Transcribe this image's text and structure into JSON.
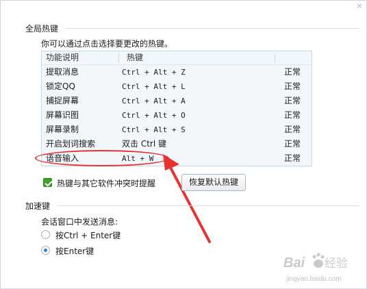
{
  "window": {
    "close_icon": "close-icon"
  },
  "global_hotkeys": {
    "section_title": "全局热键",
    "hint": "你可以通过点击选择要更改的热键。",
    "table": {
      "headers": [
        "功能说明",
        "热键",
        ""
      ],
      "rows": [
        {
          "function": "提取消息",
          "hotkey": "Ctrl + Alt + Z",
          "status": "正常"
        },
        {
          "function": "锁定QQ",
          "hotkey": "Ctrl + Alt + L",
          "status": "正常"
        },
        {
          "function": "捕捉屏幕",
          "hotkey": "Ctrl + Alt + A",
          "status": "正常"
        },
        {
          "function": "屏幕识图",
          "hotkey": "Ctrl + Alt + O",
          "status": "正常"
        },
        {
          "function": "屏幕录制",
          "hotkey": "Ctrl + Alt + S",
          "status": "正常"
        },
        {
          "function": "开启划词搜索",
          "hotkey": "双击 Ctrl 键",
          "status": "正常"
        },
        {
          "function": "语音输入",
          "hotkey": "Alt + W",
          "status": "正常"
        }
      ]
    },
    "conflict_checkbox": {
      "label": "热键与其它软件冲突时提醒",
      "checked": true
    },
    "restore_button": "恢复默认热键"
  },
  "accelerator": {
    "section_title": "加速键",
    "send_label": "会话窗口中发送消息:",
    "options": [
      {
        "label": "按Ctrl + Enter键",
        "selected": false
      },
      {
        "label": "按Enter键",
        "selected": true
      }
    ]
  },
  "annotation": {
    "color": "#e8322f"
  },
  "watermark": {
    "brand": "Baidu经验",
    "url": "jingyan.baidu.com"
  }
}
